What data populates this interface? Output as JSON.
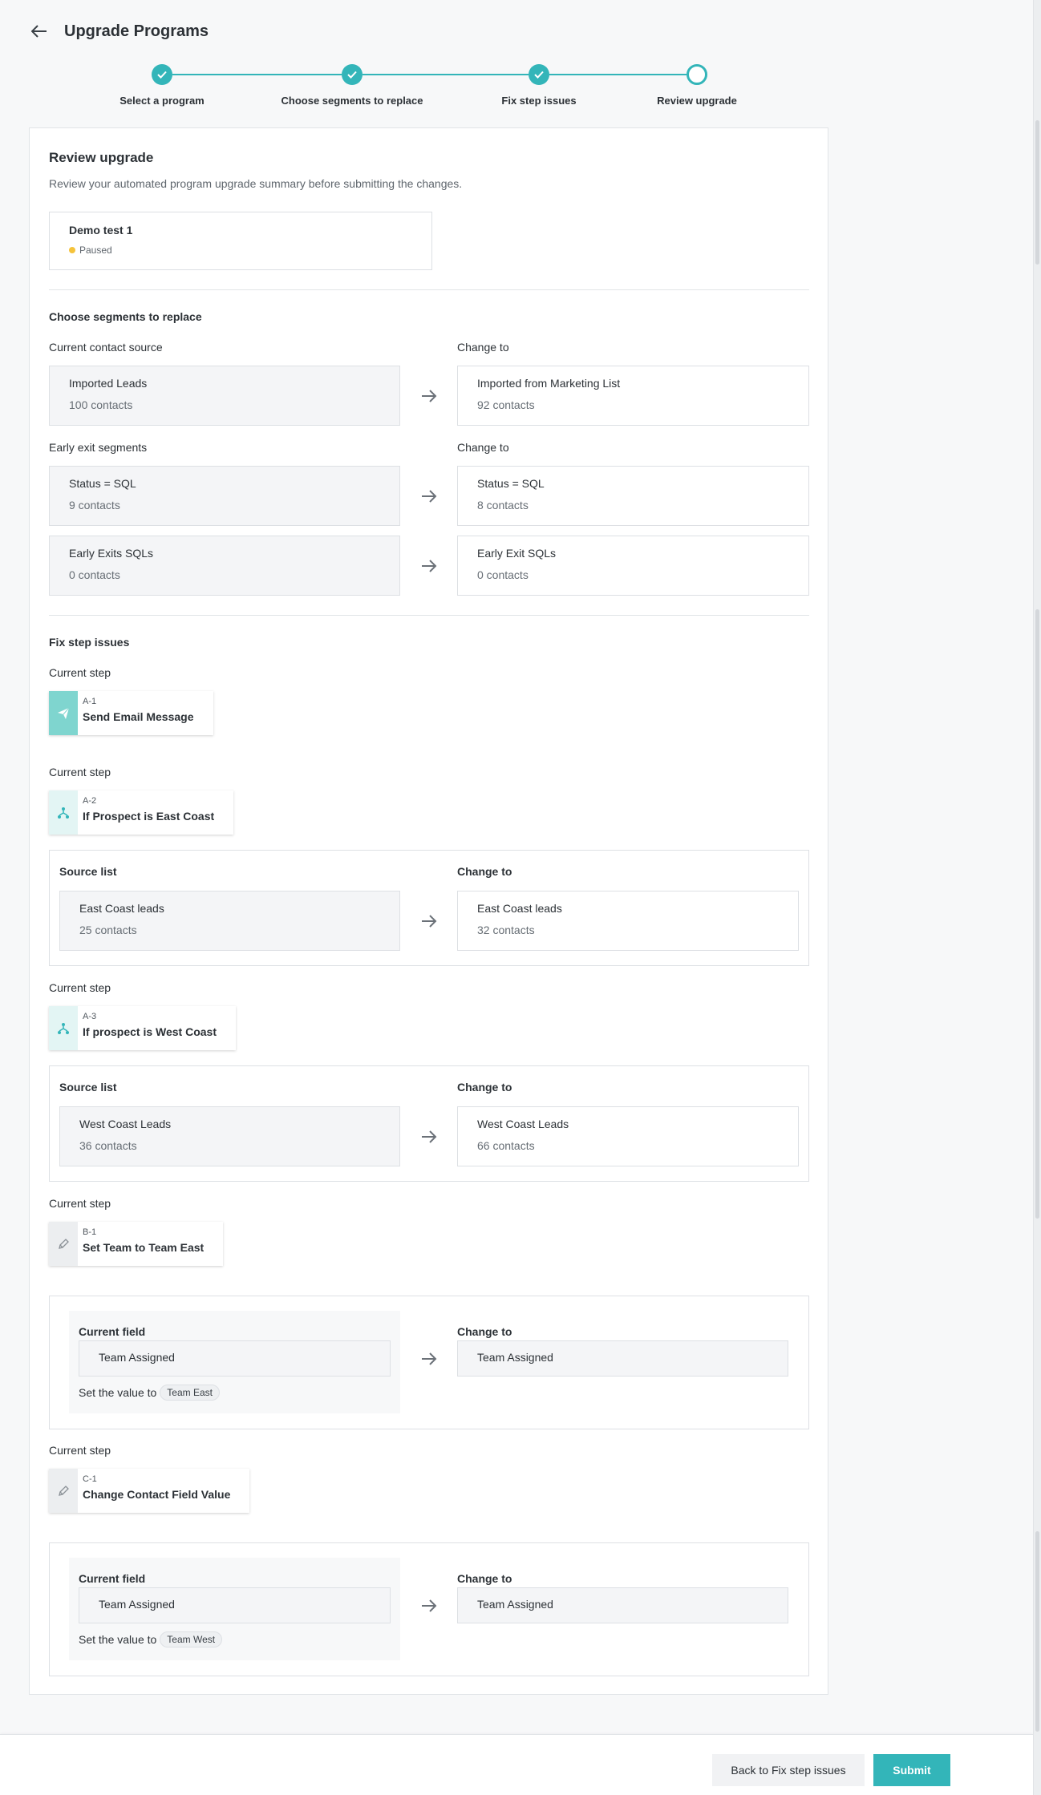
{
  "header": {
    "title": "Upgrade Programs",
    "back_icon": "arrow-left-icon"
  },
  "stepper": {
    "steps": [
      {
        "label": "Select a program",
        "state": "done"
      },
      {
        "label": "Choose segments to replace",
        "state": "done"
      },
      {
        "label": "Fix step issues",
        "state": "done"
      },
      {
        "label": "Review upgrade",
        "state": "current"
      }
    ]
  },
  "review": {
    "title": "Review upgrade",
    "subtitle": "Review your automated program upgrade summary before submitting the changes.",
    "program": {
      "name": "Demo test 1",
      "status": "Paused",
      "status_color": "#f5c33b"
    }
  },
  "segments": {
    "title": "Choose segments to replace",
    "contact_source": {
      "current_label": "Current contact source",
      "change_label": "Change to",
      "current": {
        "name": "Imported Leads",
        "count": "100 contacts"
      },
      "new": {
        "name": "Imported from Marketing List",
        "count": "92 contacts"
      }
    },
    "early_exit": {
      "current_label": "Early exit segments",
      "change_label": "Change to",
      "rows": [
        {
          "current": {
            "name": "Status = SQL",
            "count": "9 contacts"
          },
          "new": {
            "name": "Status = SQL",
            "count": "8 contacts"
          }
        },
        {
          "current": {
            "name": "Early Exits SQLs",
            "count": "0 contacts"
          },
          "new": {
            "name": "Early Exit SQLs",
            "count": "0 contacts"
          }
        }
      ]
    }
  },
  "fix": {
    "title": "Fix step issues",
    "current_step_label": "Current step",
    "steps": [
      {
        "code": "A-1",
        "name": "Send Email Message",
        "icon": "paper-plane-icon"
      },
      {
        "code": "A-2",
        "name": "If Prospect is East Coast",
        "icon": "branch-icon",
        "source_label": "Source list",
        "change_label": "Change to",
        "current": {
          "name": "East Coast leads",
          "count": "25 contacts"
        },
        "new": {
          "name": "East Coast leads",
          "count": "32 contacts"
        }
      },
      {
        "code": "A-3",
        "name": "If prospect is West Coast",
        "icon": "branch-icon",
        "source_label": "Source list",
        "change_label": "Change to",
        "current": {
          "name": "West Coast Leads",
          "count": "36 contacts"
        },
        "new": {
          "name": "West Coast Leads",
          "count": "66 contacts"
        }
      },
      {
        "code": "B-1",
        "name": "Set Team to Team East",
        "icon": "pencil-icon",
        "field_label": "Current field",
        "change_label": "Change to",
        "current_field": "Team Assigned",
        "new_field": "Team Assigned",
        "set_value_label": "Set the value to",
        "value": "Team East"
      },
      {
        "code": "C-1",
        "name": "Change Contact Field Value",
        "icon": "pencil-icon",
        "field_label": "Current field",
        "change_label": "Change to",
        "current_field": "Team Assigned",
        "new_field": "Team Assigned",
        "set_value_label": "Set the value to",
        "value": "Team West"
      }
    ]
  },
  "footer": {
    "back_label": "Back to Fix step issues",
    "submit_label": "Submit"
  },
  "colors": {
    "accent": "#33b5b9",
    "paused": "#f5c33b"
  }
}
